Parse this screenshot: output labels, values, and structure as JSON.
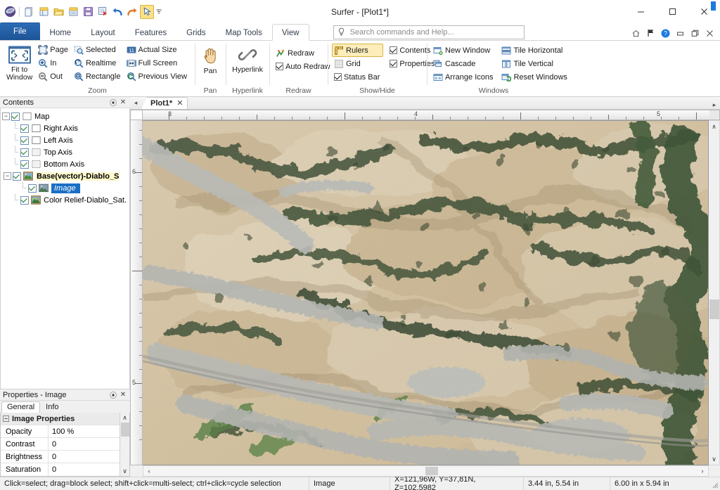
{
  "window": {
    "title": "Surfer - [Plot1*]",
    "minimize": "─",
    "maximize": "☐",
    "close": "✕"
  },
  "quick_access": [
    {
      "name": "surfer-logo-icon",
      "label": "Surfer"
    },
    {
      "name": "new-plot-icon",
      "label": "New Plot"
    },
    {
      "name": "new-worksheet-icon",
      "label": "New Worksheet"
    },
    {
      "name": "open-icon",
      "label": "Open"
    },
    {
      "name": "open-recent-icon",
      "label": "Open Recent"
    },
    {
      "name": "save-icon",
      "label": "Save"
    },
    {
      "name": "export-icon",
      "label": "Export"
    },
    {
      "name": "undo-icon",
      "label": "Undo"
    },
    {
      "name": "redo-icon",
      "label": "Redo"
    },
    {
      "name": "select-tool-icon",
      "label": "Select"
    },
    {
      "name": "customize-qat-icon",
      "label": "Customize Quick Access Toolbar"
    }
  ],
  "tabs": [
    {
      "label": "File",
      "active": false,
      "file": true
    },
    {
      "label": "Home",
      "active": false
    },
    {
      "label": "Layout",
      "active": false
    },
    {
      "label": "Features",
      "active": false
    },
    {
      "label": "Grids",
      "active": false
    },
    {
      "label": "Map Tools",
      "active": false
    },
    {
      "label": "View",
      "active": true
    }
  ],
  "search": {
    "placeholder": "Search commands and Help...",
    "value": ""
  },
  "tab_right_icons": [
    {
      "name": "ribbon-home-icon",
      "glyph": "⌂"
    },
    {
      "name": "flag-icon",
      "glyph": "⚑"
    },
    {
      "name": "help-icon",
      "glyph": "?"
    },
    {
      "name": "minimize-ribbon-icon",
      "glyph": "−"
    },
    {
      "name": "restore-window-icon",
      "glyph": "❐"
    },
    {
      "name": "close-document-icon",
      "glyph": "✕"
    }
  ],
  "ribbon": {
    "groups": [
      {
        "name": "zoom",
        "label": "Zoom",
        "big_button": {
          "label_line1": "Fit to",
          "label_line2": "Window",
          "icon": "fit-to-window-icon"
        },
        "columns": [
          [
            {
              "label": "Page",
              "icon": "zoom-page-icon"
            },
            {
              "label": "In",
              "icon": "zoom-in-icon"
            },
            {
              "label": "Out",
              "icon": "zoom-out-icon"
            }
          ],
          [
            {
              "label": "Selected",
              "icon": "zoom-selected-icon"
            },
            {
              "label": "Realtime",
              "icon": "zoom-realtime-icon"
            },
            {
              "label": "Rectangle",
              "icon": "zoom-rectangle-icon"
            }
          ],
          [
            {
              "label": "Actual Size",
              "icon": "actual-size-icon"
            },
            {
              "label": "Full Screen",
              "icon": "full-screen-icon"
            },
            {
              "label": "Previous View",
              "icon": "previous-view-icon"
            }
          ]
        ]
      },
      {
        "name": "pan",
        "label": "Pan",
        "big_button": {
          "label_line1": "Pan",
          "label_line2": "",
          "icon": "pan-hand-icon"
        }
      },
      {
        "name": "hyperlink",
        "label": "Hyperlink",
        "big_button": {
          "label_line1": "Hyperlink",
          "label_line2": "",
          "icon": "hyperlink-chain-icon"
        }
      },
      {
        "name": "redraw",
        "label": "Redraw",
        "items": [
          {
            "label": "Redraw",
            "icon": "redraw-icon",
            "type": "button"
          },
          {
            "label": "Auto Redraw",
            "icon": "checkbox-icon",
            "type": "checkbox",
            "checked": true
          }
        ]
      },
      {
        "name": "show-hide",
        "label": "Show/Hide",
        "columns": [
          [
            {
              "label": "Rulers",
              "icon": "rulers-icon",
              "type": "toggle",
              "checked": true,
              "active": true
            },
            {
              "label": "Grid",
              "icon": "grid-icon",
              "type": "toggle",
              "checked": false
            },
            {
              "label": "Status Bar",
              "icon": "checkbox-icon",
              "type": "checkbox",
              "checked": true
            }
          ],
          [
            {
              "label": "Contents",
              "icon": "checkbox-icon",
              "type": "checkbox",
              "checked": true
            },
            {
              "label": "Properties",
              "icon": "checkbox-icon",
              "type": "checkbox",
              "checked": true
            }
          ]
        ]
      },
      {
        "name": "windows",
        "label": "Windows",
        "columns": [
          [
            {
              "label": "New Window",
              "icon": "new-window-icon"
            },
            {
              "label": "Cascade",
              "icon": "cascade-icon"
            },
            {
              "label": "Arrange Icons",
              "icon": "arrange-icons-icon"
            }
          ],
          [
            {
              "label": "Tile Horizontal",
              "icon": "tile-horizontal-icon"
            },
            {
              "label": "Tile Vertical",
              "icon": "tile-vertical-icon"
            },
            {
              "label": "Reset Windows",
              "icon": "reset-windows-icon"
            }
          ]
        ]
      }
    ]
  },
  "contents_panel": {
    "title": "Contents",
    "pin_glyph": "⦿",
    "close_glyph": "✕",
    "tree": [
      {
        "label": "Map",
        "depth": 0,
        "expander": "−",
        "checked": true,
        "icon": "map-icon",
        "state": "normal"
      },
      {
        "label": "Right Axis",
        "depth": 1,
        "expander": null,
        "checked": true,
        "icon": "axis-icon",
        "state": "normal"
      },
      {
        "label": "Left Axis",
        "depth": 1,
        "expander": null,
        "checked": true,
        "icon": "axis-icon",
        "state": "normal"
      },
      {
        "label": "Top Axis",
        "depth": 1,
        "expander": null,
        "checked": true,
        "icon": "axis-icon",
        "state": "normal"
      },
      {
        "label": "Bottom Axis",
        "depth": 1,
        "expander": null,
        "checked": true,
        "icon": "axis-icon",
        "state": "normal"
      },
      {
        "label": "Base(vector)-Diablo_S",
        "depth": 1,
        "expander": "−",
        "checked": true,
        "icon": "base-vector-icon",
        "state": "bold"
      },
      {
        "label": "Image",
        "depth": 2,
        "expander": null,
        "checked": true,
        "icon": "image-layer-icon",
        "state": "selected"
      },
      {
        "label": "Color Relief-Diablo_Sat.",
        "depth": 1,
        "expander": null,
        "checked": true,
        "icon": "color-relief-icon",
        "state": "normal"
      }
    ]
  },
  "properties_panel": {
    "title": "Properties - Image",
    "pin_glyph": "⦿",
    "close_glyph": "✕",
    "tabs": [
      {
        "label": "General",
        "active": true
      },
      {
        "label": "Info",
        "active": false
      }
    ],
    "section": {
      "label": "Image Properties",
      "expander": "−"
    },
    "rows": [
      {
        "name": "Opacity",
        "value": "100 %"
      },
      {
        "name": "Contrast",
        "value": "0"
      },
      {
        "name": "Brightness",
        "value": "0"
      },
      {
        "name": "Saturation",
        "value": "0"
      }
    ],
    "scroll_up": "∧",
    "scroll_down": "∨"
  },
  "document": {
    "tab_label": "Plot1*",
    "tab_close": "✕",
    "nav_left": "◂",
    "nav_right": "▸"
  },
  "rulers": {
    "horizontal_labels": [
      "3",
      "4",
      "5"
    ],
    "vertical_labels": [
      "6",
      "5"
    ],
    "units": "in"
  },
  "scrollbars": {
    "up": "∧",
    "down": "∨",
    "left": "‹",
    "right": "›"
  },
  "statusbar": {
    "hint": "Click=select; drag=block select; shift+click=multi-select; ctrl+click=cycle selection",
    "object": "Image",
    "coordinates": "X=121,96W, Y=37,81N, Z=102,5982",
    "position": "3.44 in, 5.54 in",
    "size": "6.00 in x 5.94 in"
  },
  "colors": {
    "accent": "#1d5496",
    "file_tab": "#2c6bb5",
    "selection": "#1a6fc4",
    "highlight": "#fff9cc",
    "toggle_on": "#fdedbb",
    "slider": "#1b7ae0",
    "terrain_tan": "#d8c6a8",
    "terrain_light": "#e8dcc4",
    "vegetation": "#3a4a33",
    "urban": "#b8b8b4"
  }
}
